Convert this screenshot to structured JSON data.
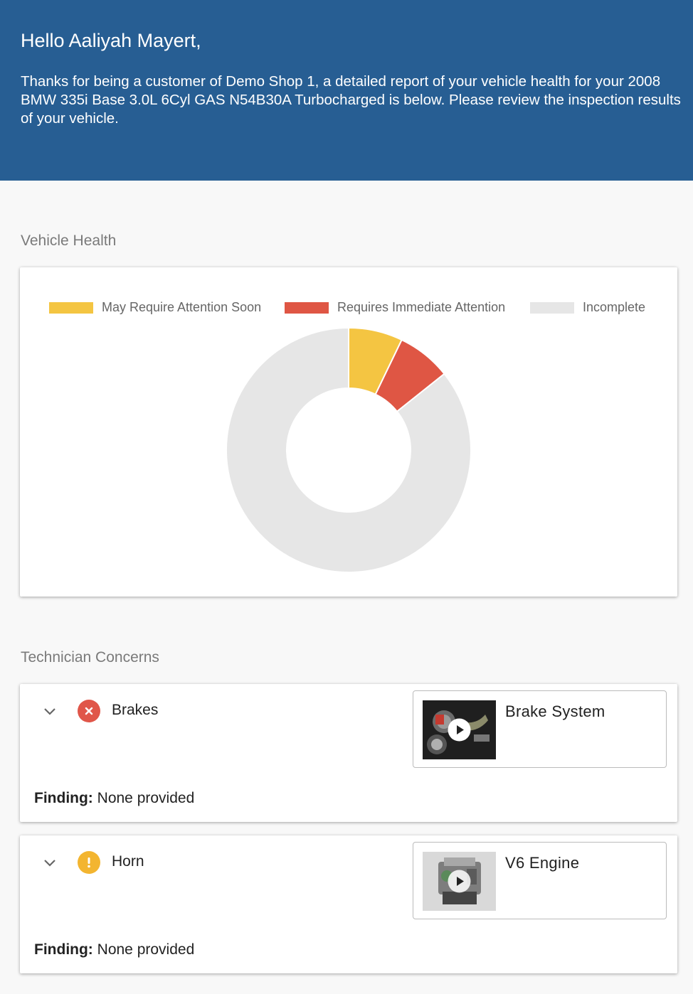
{
  "header": {
    "greeting": "Hello Aaliyah Mayert,",
    "intro": "Thanks for being a customer of Demo Shop 1, a detailed report of your vehicle health for your 2008 BMW 335i Base 3.0L 6Cyl GAS N54B30A Turbocharged is below. Please review the inspection results of your vehicle."
  },
  "vehicle_health": {
    "title": "Vehicle Health"
  },
  "chart_data": {
    "type": "pie",
    "donut": true,
    "legend_position": "top",
    "categories": [
      "May Require Attention Soon",
      "Requires Immediate Attention",
      "Incomplete"
    ],
    "values": [
      1,
      1,
      12
    ],
    "colors": [
      "#f4c542",
      "#df5644",
      "#e6e6e6"
    ]
  },
  "technician_concerns": {
    "title": "Technician Concerns",
    "finding_label": "Finding:",
    "items": [
      {
        "name": "Brakes",
        "status": "immediate",
        "status_color": "#e05649",
        "status_icon": "x-circle-icon",
        "finding": "None provided",
        "video": {
          "title": "Brake System",
          "thumb_icon": "brake-system-thumbnail"
        }
      },
      {
        "name": "Horn",
        "status": "soon",
        "status_color": "#f3b530",
        "status_icon": "exclamation-circle-icon",
        "finding": "None provided",
        "video": {
          "title": "V6 Engine",
          "thumb_icon": "engine-thumbnail"
        }
      }
    ]
  }
}
